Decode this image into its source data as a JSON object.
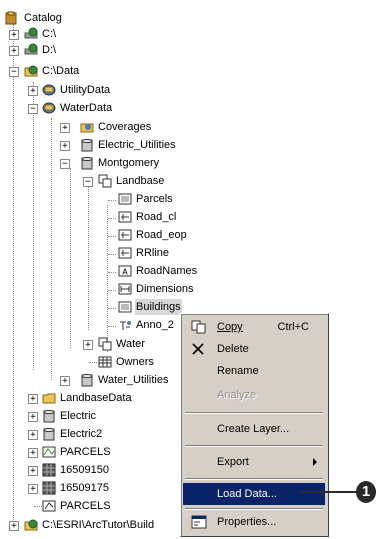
{
  "tree": {
    "catalog": "Catalog",
    "c": "C:\\",
    "d": "D:\\",
    "cdata": "C:\\Data",
    "utilitydata": "UtilityData",
    "waterdata": "WaterData",
    "coverages": "Coverages",
    "electric_utilities": "Electric_Utilities",
    "montgomery": "Montgomery",
    "landbase": "Landbase",
    "parcels": "Parcels",
    "road_cl": "Road_cl",
    "road_eop": "Road_eop",
    "rrline": "RRline",
    "roadnames": "RoadNames",
    "dimensions": "Dimensions",
    "buildings": "Buildings",
    "anno": "Anno_2",
    "water": "Water",
    "owners": "Owners",
    "water_utilities": "Water_Utilities",
    "landbasedata": "LandbaseData",
    "electric": "Electric",
    "electric2": "Electric2",
    "parcels_cov": "PARCELS",
    "n16509150": "16509150",
    "n16509175": "16509175",
    "parcels_shp": "PARCELS",
    "esri": "C:\\ESRI\\ArcTutor\\Build"
  },
  "menu": {
    "copy": "Copy",
    "copy_shortcut": "Ctrl+C",
    "delete": "Delete",
    "rename": "Rename",
    "analyze": "Analyze",
    "create_layer": "Create Layer...",
    "export": "Export",
    "load_data": "Load Data...",
    "properties": "Properties..."
  },
  "callout": "1",
  "colors": {
    "highlight": "#0a246a",
    "menu_bg": "#d4d0c8"
  }
}
